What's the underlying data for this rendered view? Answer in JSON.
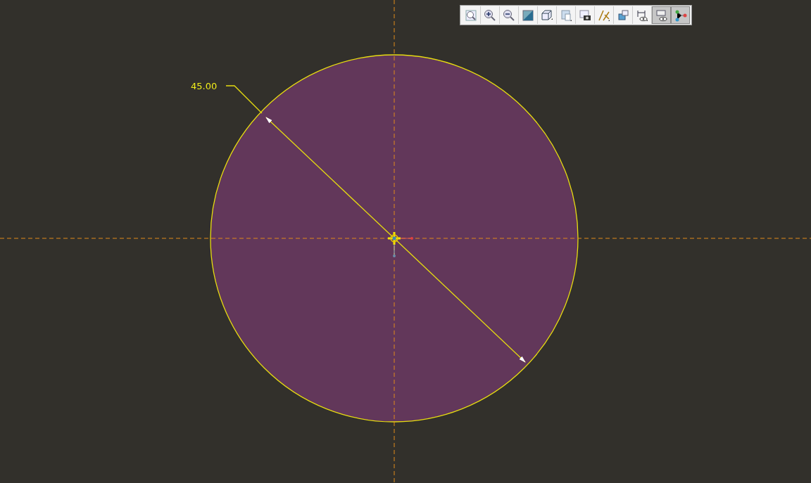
{
  "toolbar": {
    "buttons": [
      {
        "kind": "refit",
        "selected": false
      },
      {
        "kind": "zoomin",
        "selected": false
      },
      {
        "kind": "zoomout",
        "selected": false
      },
      {
        "kind": "shading",
        "selected": false
      },
      {
        "kind": "cube",
        "selected": false
      },
      {
        "kind": "views",
        "selected": false
      },
      {
        "kind": "camera",
        "selected": false
      },
      {
        "kind": "constraints",
        "selected": false
      },
      {
        "kind": "datums",
        "selected": false
      },
      {
        "kind": "dimensions",
        "selected": false
      },
      {
        "kind": "display",
        "selected": true
      },
      {
        "kind": "graph",
        "selected": true
      }
    ]
  },
  "sketch": {
    "dimension": {
      "label": "45.00"
    }
  }
}
